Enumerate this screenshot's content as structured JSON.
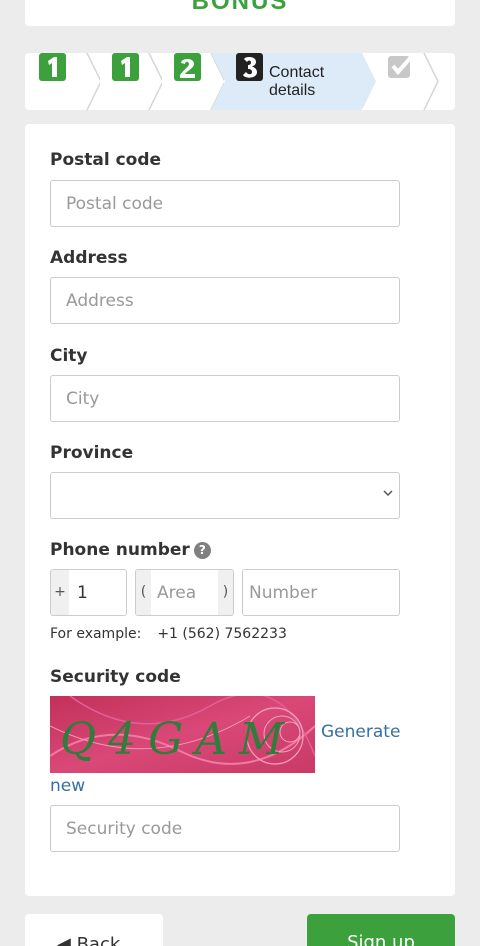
{
  "header": {
    "bonus_text": "BONUS"
  },
  "steps": {
    "items": [
      {
        "icon": "step-1-icon"
      },
      {
        "icon": "step-1-icon"
      },
      {
        "icon": "step-2-icon"
      },
      {
        "icon": "step-3-icon",
        "label_line1": "Contact",
        "label_line2": "details",
        "active": true
      },
      {
        "icon": "checkmark-icon"
      }
    ],
    "colors": {
      "done": "#3ca03c",
      "active_bg": "#ddeaf8",
      "pending": "#c8c8c8"
    }
  },
  "form": {
    "postal": {
      "label": "Postal code",
      "placeholder": "Postal code"
    },
    "address": {
      "label": "Address",
      "placeholder": "Address"
    },
    "city": {
      "label": "City",
      "placeholder": "City"
    },
    "province": {
      "label": "Province",
      "value": ""
    },
    "phone": {
      "label": "Phone number",
      "plus": "+",
      "country_code": "1",
      "paren_open": "(",
      "area_placeholder": "Area",
      "paren_close": ")",
      "number_placeholder": "Number",
      "example_label": "For example:",
      "example_value": "+1 (562) 7562233"
    },
    "security": {
      "label": "Security code",
      "captcha_text": "Q4GAM",
      "generate_line1": "Generate",
      "generate_line2": "new",
      "placeholder": "Security code"
    }
  },
  "footer": {
    "back_label": "Back",
    "signup_label": "Sign up"
  }
}
